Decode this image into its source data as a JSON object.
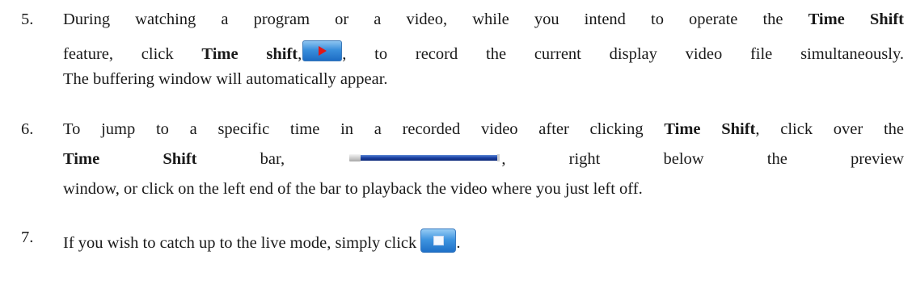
{
  "steps": [
    {
      "number": "5.",
      "l1_a": "During watching a program or a video, while you intend to operate the ",
      "l1_b": "Time Shift",
      "l2_a": "feature, click ",
      "l2_b": "Time shift",
      "l2_c": ",",
      "l2_d": ", to record the current display video file simultaneously.",
      "l3": "The buffering window will automatically appear.",
      "icon": "time-shift-play-icon"
    },
    {
      "number": "6.",
      "l1_a": "To jump to a specific time in a recorded video after clicking ",
      "l1_b": "Time Shift",
      "l1_c": ", click over the",
      "l2_a": "Time Shift",
      "l2_b": " bar, ",
      "l2_c": ", right below the preview",
      "l3": "window, or click on the left end of the bar to playback the video where you just left off.",
      "icon": "time-shift-bar"
    },
    {
      "number": "7.",
      "l1_a": "If you wish to catch up to the live mode, simply click ",
      "l1_b": ".",
      "icon": "live-mode-stop-icon"
    }
  ]
}
